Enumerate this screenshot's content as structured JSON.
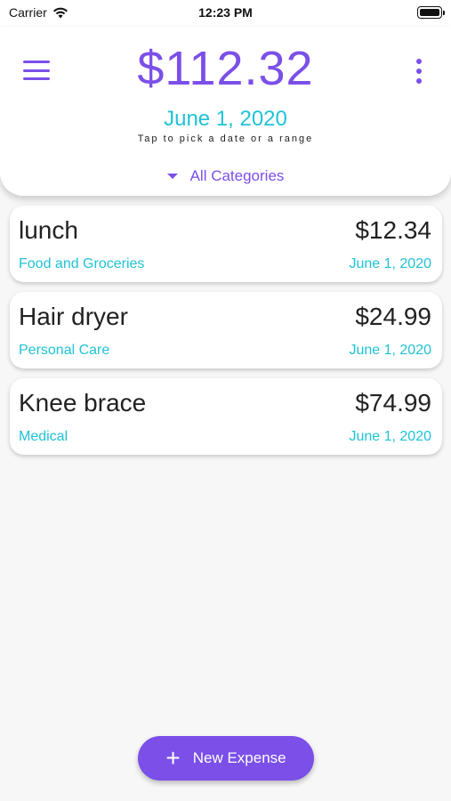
{
  "status_bar": {
    "carrier": "Carrier",
    "time": "12:23 PM"
  },
  "header": {
    "total": "$112.32",
    "date": "June 1, 2020",
    "hint": "Tap to pick a date or a range",
    "category_filter": "All Categories",
    "menu_icon": "hamburger-menu-icon",
    "more_icon": "more-vertical-icon"
  },
  "expenses": [
    {
      "title": "lunch",
      "amount": "$12.34",
      "category": "Food and Groceries",
      "date": "June 1, 2020"
    },
    {
      "title": "Hair dryer",
      "amount": "$24.99",
      "category": "Personal Care",
      "date": "June 1, 2020"
    },
    {
      "title": "Knee brace",
      "amount": "$74.99",
      "category": "Medical",
      "date": "June 1, 2020"
    }
  ],
  "fab": {
    "label": "New Expense",
    "icon": "plus-icon"
  },
  "colors": {
    "accent": "#7b4fe8",
    "secondary": "#1fc3d6",
    "background": "#f7f7f7"
  }
}
